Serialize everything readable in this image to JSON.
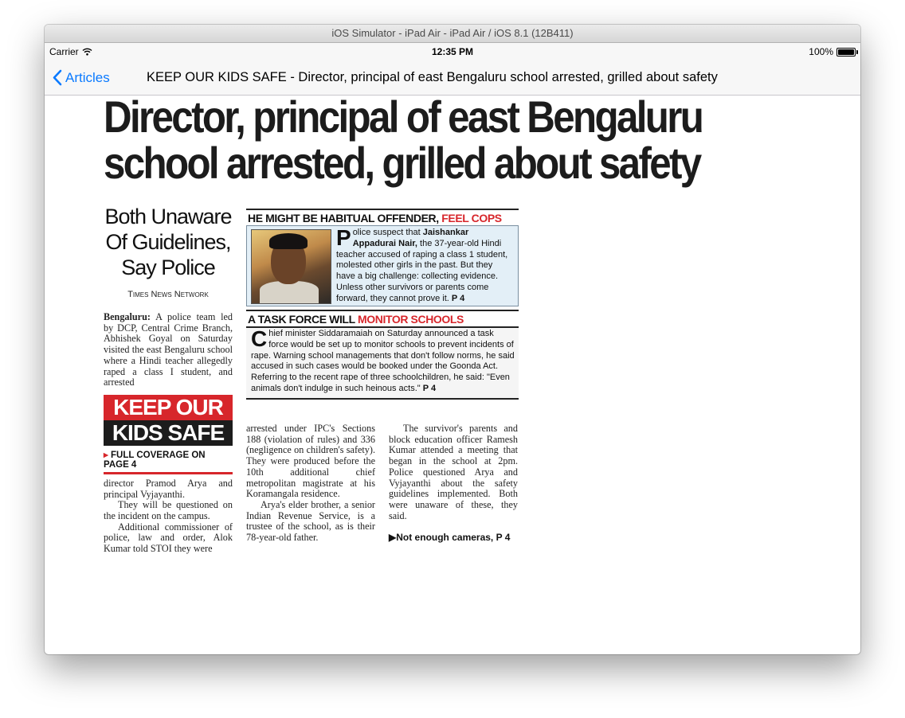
{
  "window": {
    "title": "iOS Simulator - iPad Air - iPad Air / iOS 8.1 (12B411)"
  },
  "statusbar": {
    "carrier": "Carrier",
    "time": "12:35 PM",
    "battery": "100%",
    "battery_level": 1.0
  },
  "navbar": {
    "back_label": "Articles",
    "title": "KEEP OUR KIDS SAFE -  Director, principal of east Bengaluru school arrested, grilled about safety"
  },
  "article": {
    "headline_line1": "Director, principal of east Bengaluru",
    "headline_line2": "school arrested, grilled about safety",
    "subhead_line1": "Both Unaware",
    "subhead_line2": "Of Guidelines,",
    "subhead_line3": "Say Police",
    "byline": "Times News Network",
    "intro_dateline": "Bengaluru:",
    "intro_text": "A police team led by DCP, Central Crime Branch, Abhishek Goyal on Saturday visited the east Bengaluru school where a Hindi teacher allegedly raped a class I student, and arrested",
    "keep_line1": "KEEP OUR",
    "keep_line2": "KIDS SAFE",
    "coverage": "FULL COVERAGE ON PAGE 4",
    "col1_para1": "director Pramod Arya and principal Vyjayanthi.",
    "col1_para2": "They will be questioned on the incident on the campus.",
    "col1_para3": "Additional commissioner of police, law and order, Alok Kumar told STOI they were",
    "sidebar1_head": "HE MIGHT BE HABITUAL OFFENDER,",
    "sidebar1_head_red": "FEEL COPS",
    "sidebar1_dropcap": "P",
    "sidebar1_text_a": "olice suspect that",
    "sidebar1_name": "Jaishankar Appadurai Nair,",
    "sidebar1_text_b": "the 37-year-old Hindi teacher accused of raping a class 1 student, molested other girls in the past. But they have a big challenge: collecting evidence. Unless other survivors or parents come forward, they cannot prove it.",
    "sidebar1_ref": "P 4",
    "sidebar2_head": "A TASK FORCE WILL",
    "sidebar2_head_red": "MONITOR SCHOOLS",
    "sidebar2_dropcap": "C",
    "sidebar2_text": "hief minister Siddaramaiah on Saturday announced a task force would be set up to monitor schools to prevent incidents of rape. Warning school managements that don't follow norms, he said accused in such cases would be booked under the Goonda Act. Referring to the recent rape of three schoolchildren, he said: \"Even animals don't indulge in such heinous acts.\"",
    "sidebar2_ref": "P 4",
    "col2_para1": "arrested under IPC's Sections 188 (violation of rules) and 336 (negligence on children's safety). They were produced before the 10th additional chief metropolitan magistrate at his Koramangala residence.",
    "col2_para2": "Arya's elder brother, a senior Indian Revenue Service, is a trustee of the school, as is their 78-year-old father.",
    "col3_para1": "The survivor's parents and block education officer Ramesh Kumar attended a meeting that began in the school at 2pm. Police questioned Arya and Vyjayanthi about the safety guidelines implemented. Both were unaware of these, they said.",
    "col3_more": "Not enough cameras, P 4"
  },
  "colors": {
    "accent_blue": "#0a7aff",
    "headline_red": "#d7262b"
  },
  "icons": {
    "wifi": "wifi-icon",
    "back": "chevron-left-icon",
    "battery": "battery-icon",
    "arrow": "triangle-right-icon"
  }
}
